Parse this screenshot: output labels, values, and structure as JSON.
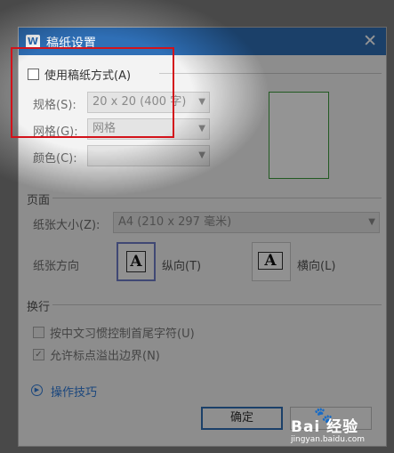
{
  "titlebar": {
    "title": "稿纸设置",
    "app_icon": "W"
  },
  "manuscript": {
    "use_label": "使用稿纸方式(A)",
    "spec_label": "规格(S):",
    "spec_value": "20 x 20 (400 字)",
    "grid_label": "网格(G):",
    "grid_value": "网格",
    "color_label": "颜色(C):",
    "color_value": ""
  },
  "page": {
    "section_title": "页面",
    "paper_size_label": "纸张大小(Z):",
    "paper_size_value": "A4 (210 x 297 毫米)",
    "orientation_label": "纸张方向",
    "portrait_label": "纵向(T)",
    "landscape_label": "横向(L)",
    "page_icon_letter": "A"
  },
  "linebreak": {
    "section_title": "换行",
    "option1_label": "按中文习惯控制首尾字符(U)",
    "option2_label": "允许标点溢出边界(N)",
    "option2_checkmark": "✓"
  },
  "help": {
    "link_text": "操作技巧"
  },
  "buttons": {
    "ok_label": "确定"
  },
  "watermark": {
    "logo": "Bai 经验",
    "url": "jingyan.baidu.com"
  },
  "colors": {
    "titlebar": "#2f6fb6",
    "highlight": "#d3131b",
    "link": "#2f7ad8",
    "preview_border": "#3c9c3c"
  }
}
